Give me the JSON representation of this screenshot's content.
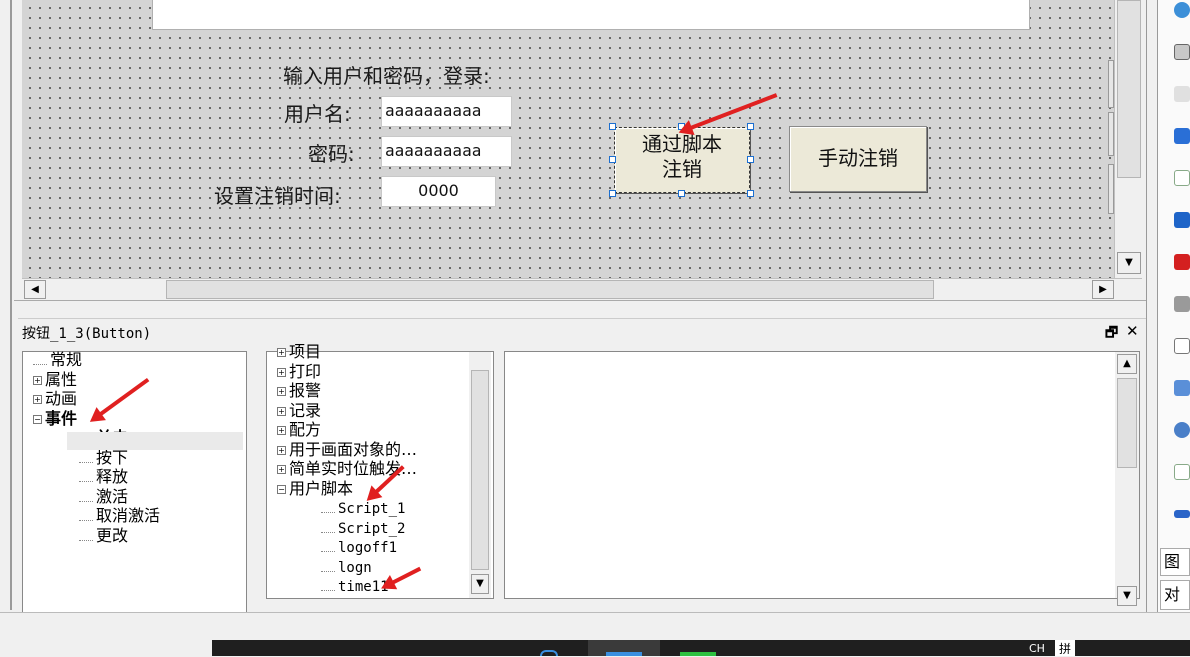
{
  "canvas": {
    "prompt": "输入用户和密码，登录:",
    "user_label": "用户名:",
    "user_value": "aaaaaaaaaa",
    "pwd_label": "密码:",
    "pwd_value": "aaaaaaaaaa",
    "logout_time_label": "设置注销时间:",
    "logout_time_value": "0000",
    "script_logout_button": "通过脚本注销",
    "manual_logout_button": "手动注销"
  },
  "props": {
    "title": "按钮_1_3(Button)",
    "pin_icon": "🗗",
    "close_icon": "✕",
    "tree1": [
      {
        "label": "常规",
        "pm": ""
      },
      {
        "label": "属性",
        "pm": "+"
      },
      {
        "label": "动画",
        "pm": "+"
      },
      {
        "label": "事件",
        "pm": "−"
      },
      {
        "label": "单击",
        "pm": ""
      },
      {
        "label": "按下",
        "pm": ""
      },
      {
        "label": "释放",
        "pm": ""
      },
      {
        "label": "激活",
        "pm": ""
      },
      {
        "label": "取消激活",
        "pm": ""
      },
      {
        "label": "更改",
        "pm": ""
      }
    ],
    "tree2": [
      {
        "label": "项目",
        "pm": "+"
      },
      {
        "label": "打印",
        "pm": "+"
      },
      {
        "label": "报警",
        "pm": "+"
      },
      {
        "label": "记录",
        "pm": "+"
      },
      {
        "label": "配方",
        "pm": "+"
      },
      {
        "label": "用于画面对象的…",
        "pm": "+"
      },
      {
        "label": "简单实时位触发…",
        "pm": "+"
      },
      {
        "label": "用户脚本",
        "pm": "−"
      },
      {
        "label": "Script_1",
        "pm": ""
      },
      {
        "label": "Script_2",
        "pm": ""
      },
      {
        "label": "logoff1",
        "pm": ""
      },
      {
        "label": "logn",
        "pm": ""
      },
      {
        "label": "time11",
        "pm": ""
      }
    ]
  },
  "right_tabs": [
    "图册",
    "对象"
  ],
  "taskbar": {
    "ime": "CH",
    "ime2": "拼"
  },
  "colors": {
    "canvas_bg": "#d4d4d4",
    "selection": "#1c6fd0",
    "annotation_arrow": "#e02020",
    "taskbar": "#1f1f1f"
  }
}
